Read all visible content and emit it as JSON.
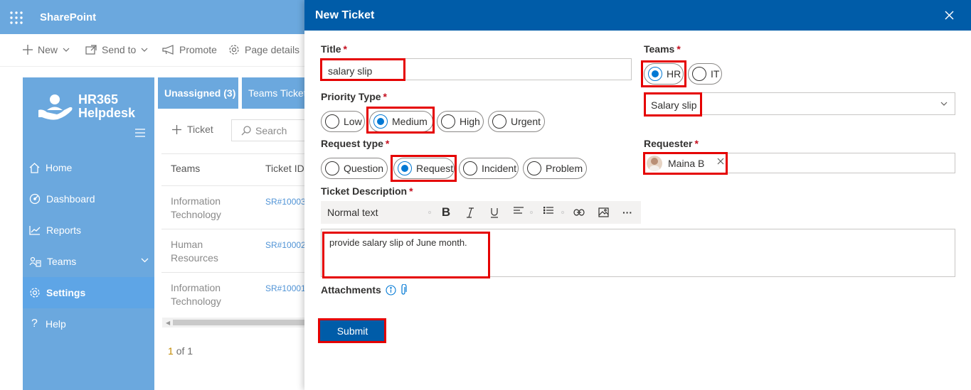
{
  "app": {
    "title": "SharePoint"
  },
  "commandbar": {
    "new": "New",
    "send_to": "Send to",
    "promote": "Promote",
    "page_details": "Page details"
  },
  "sidebar": {
    "logo_line1": "HR365",
    "logo_line2": "Helpdesk",
    "items": [
      {
        "label": "Home",
        "icon": "home-icon"
      },
      {
        "label": "Dashboard",
        "icon": "dashboard-icon"
      },
      {
        "label": "Reports",
        "icon": "reports-icon"
      },
      {
        "label": "Teams",
        "icon": "teams-icon"
      },
      {
        "label": "Settings",
        "icon": "gear-icon",
        "active": true
      },
      {
        "label": "Help",
        "icon": "help-icon"
      }
    ]
  },
  "tabs": [
    "Unassigned (3)",
    "Teams Tickets"
  ],
  "list": {
    "add_ticket": "Ticket",
    "search_placeholder": "Search",
    "columns": [
      "Teams",
      "Ticket ID"
    ],
    "rows": [
      {
        "team_line1": "Information",
        "team_line2": "Technology",
        "id": "SR#10003"
      },
      {
        "team_line1": "Human",
        "team_line2": "Resources",
        "id": "SR#10002"
      },
      {
        "team_line1": "Information",
        "team_line2": "Technology",
        "id": "SR#10001"
      }
    ],
    "pager": {
      "current": "1",
      "of": "of 1"
    }
  },
  "panel": {
    "title": "New Ticket",
    "title_label": "Title",
    "title_value": "salary slip",
    "priority_label": "Priority Type",
    "priority_options": [
      "Low",
      "Medium",
      "High",
      "Urgent"
    ],
    "priority_selected": "Medium",
    "request_type_label": "Request type",
    "request_options": [
      "Question",
      "Request",
      "Incident",
      "Problem"
    ],
    "request_selected": "Request",
    "teams_label": "Teams",
    "teams_options": [
      "HR",
      "IT"
    ],
    "teams_selected": "HR",
    "category_value": "Salary slip",
    "requester_label": "Requester",
    "requester_name": "Maina B",
    "description_label": "Ticket Description",
    "toolbar_style": "Normal text",
    "description_value": "provide salary slip of June month.",
    "attachments_label": "Attachments",
    "submit_label": "Submit",
    "required_mark": "*"
  },
  "colors": {
    "suite_bar": "#6ba8de",
    "panel_header": "#005ca8",
    "accent": "#0078d4",
    "highlight_box": "#e50000"
  }
}
